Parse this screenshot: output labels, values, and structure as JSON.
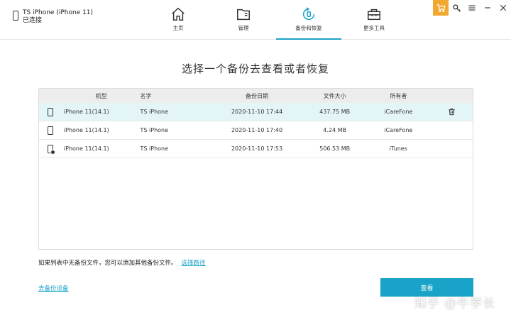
{
  "device": {
    "name": "TS iPhone (iPhone 11)",
    "status": "已连接"
  },
  "nav": [
    {
      "label": "主页",
      "icon": "home-icon"
    },
    {
      "label": "管理",
      "icon": "folder-icon"
    },
    {
      "label": "备份和恢复",
      "icon": "backup-restore-icon",
      "active": true
    },
    {
      "label": "更多工具",
      "icon": "toolbox-icon"
    }
  ],
  "window_controls": [
    "cart-icon",
    "key-icon",
    "menu-icon",
    "minimize-icon",
    "close-icon"
  ],
  "title": "选择一个备份去查看或者恢复",
  "table": {
    "headers": {
      "model": "机型",
      "name": "名字",
      "date": "备份日期",
      "size": "文件大小",
      "owner": "所有者"
    },
    "rows": [
      {
        "model": "iPhone 11(14.1)",
        "name": "TS iPhone",
        "date": "2020-11-10 17:44",
        "size": "437.75 MB",
        "owner": "iCareFone",
        "selected": true,
        "locked": false
      },
      {
        "model": "iPhone 11(14.1)",
        "name": "TS iPhone",
        "date": "2020-11-10 17:40",
        "size": "4.24 MB",
        "owner": "iCareFone",
        "selected": false,
        "locked": false
      },
      {
        "model": "iPhone 11(14.1)",
        "name": "TS iPhone",
        "date": "2020-11-10 17:53",
        "size": "506.53 MB",
        "owner": "iTunes",
        "selected": false,
        "locked": true
      }
    ]
  },
  "note": {
    "text": "如果列表中无备份文件，您可以添加其他备份文件。",
    "link": "选择路径"
  },
  "bottom_link": "去备份设备",
  "view_button": "查看",
  "watermark": "知乎 @牛学长",
  "colors": {
    "accent": "#1aa3c8",
    "selected_row": "#e4f5f7",
    "cart": "#f0a830"
  }
}
